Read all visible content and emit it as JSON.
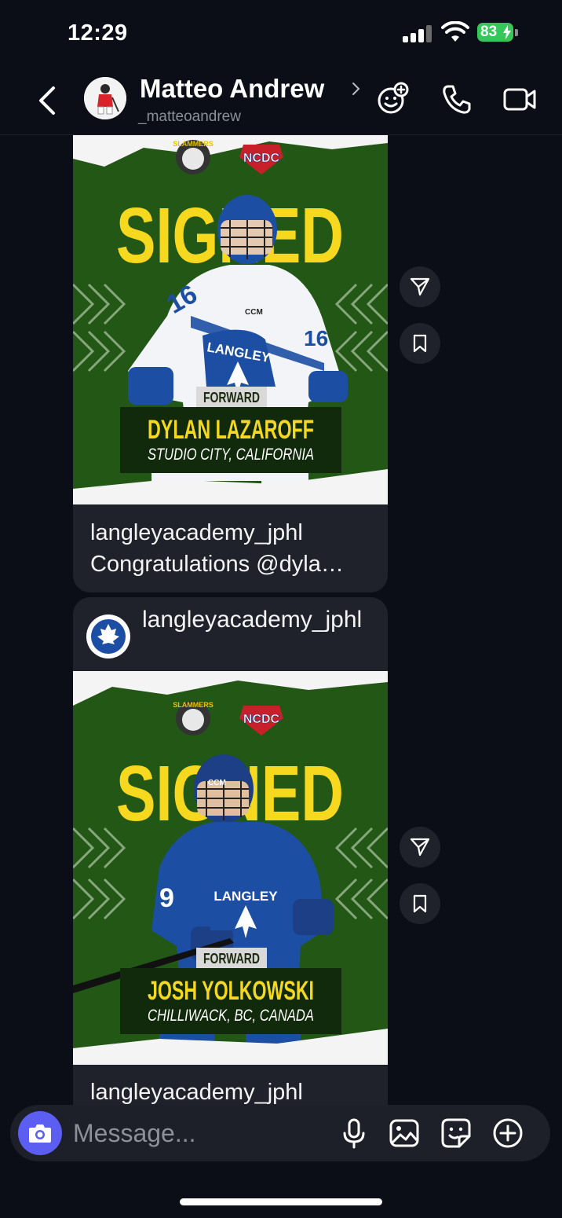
{
  "status_bar": {
    "time": "12:29",
    "battery": "83"
  },
  "header": {
    "contact_name": "Matteo Andrew",
    "username": "_matteoandrew",
    "icons": [
      "back-icon",
      "chevron-right-icon",
      "add-emoji-icon",
      "phone-icon",
      "video-camera-icon"
    ]
  },
  "posts": [
    {
      "graphic": {
        "team_logo": "SLAMMERS",
        "league_logo": "NCDC",
        "headline": "SIGNED",
        "jersey_text": "LANGLEY",
        "jersey_number": "16",
        "helmet_brand": "CCM",
        "position": "FORWARD",
        "player_name": "DYLAN LAZAROFF",
        "hometown": "STUDIO CITY, CALIFORNIA"
      },
      "caption_user": "langleyacademy_jphl",
      "caption_text": "Congratulations @dyla…"
    },
    {
      "author": "langleyacademy_jphl",
      "graphic": {
        "team_logo": "SLAMMERS",
        "league_logo": "NCDC",
        "headline": "SIGNED",
        "jersey_text": "LANGLEY",
        "jersey_number": "9",
        "helmet_brand": "CCM",
        "position": "FORWARD",
        "player_name": "JOSH YOLKOWSKI",
        "hometown": "CHILLIWACK, BC, CANADA"
      },
      "caption_user": "langleyacademy_jphl"
    }
  ],
  "composer": {
    "placeholder": "Message...",
    "icons": [
      "camera-icon",
      "microphone-icon",
      "gallery-icon",
      "sticker-icon",
      "plus-icon"
    ]
  },
  "action_icons": [
    "share-icon",
    "bookmark-icon"
  ],
  "colors": {
    "background": "#0b0e17",
    "bubble": "#1f222b",
    "accent_purple": "#5b5ef0",
    "battery_green": "#35c759",
    "poster_green": "#1f4d14",
    "poster_yellow": "#f6d81f",
    "jersey_blue": "#1c4fa3"
  }
}
